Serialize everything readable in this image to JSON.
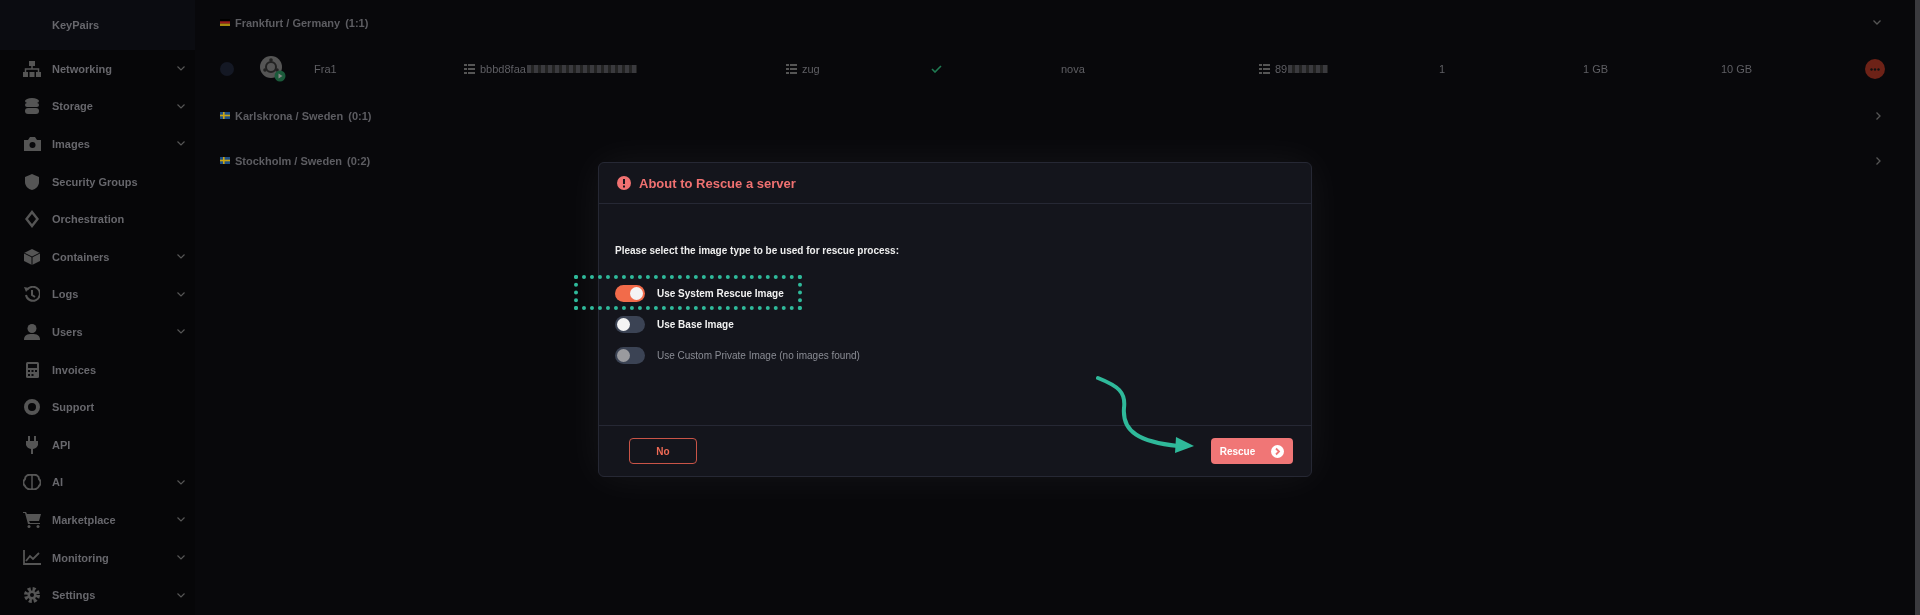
{
  "sidebar": {
    "items": [
      {
        "label": "KeyPairs",
        "expandable": false,
        "selected": true
      },
      {
        "label": "Networking",
        "expandable": true,
        "selected": false
      },
      {
        "label": "Storage",
        "expandable": true,
        "selected": false
      },
      {
        "label": "Images",
        "expandable": true,
        "selected": false
      },
      {
        "label": "Security Groups",
        "expandable": false,
        "selected": false
      },
      {
        "label": "Orchestration",
        "expandable": false,
        "selected": false
      },
      {
        "label": "Containers",
        "expandable": true,
        "selected": false
      },
      {
        "label": "Logs",
        "expandable": true,
        "selected": false
      },
      {
        "label": "Users",
        "expandable": true,
        "selected": false
      },
      {
        "label": "Invoices",
        "expandable": false,
        "selected": false
      },
      {
        "label": "Support",
        "expandable": false,
        "selected": false
      },
      {
        "label": "API",
        "expandable": false,
        "selected": false
      },
      {
        "label": "AI",
        "expandable": true,
        "selected": false
      },
      {
        "label": "Marketplace",
        "expandable": true,
        "selected": false
      },
      {
        "label": "Monitoring",
        "expandable": true,
        "selected": false
      },
      {
        "label": "Settings",
        "expandable": true,
        "selected": false
      }
    ]
  },
  "regions": [
    {
      "label": "Frankfurt / Germany",
      "count": "(1:1)",
      "expanded": true,
      "servers": [
        {
          "selected": false,
          "name": "Fra1",
          "id": "bbbd8faa",
          "flavor": "zug",
          "active": true,
          "zone": "nova",
          "ip": "89",
          "vcpus": "1",
          "ram": "1 GB",
          "disk": "10 GB"
        }
      ]
    },
    {
      "label": "Karlskrona / Sweden",
      "count": "(0:1)",
      "expanded": false
    },
    {
      "label": "Stockholm / Sweden",
      "count": "(0:2)",
      "expanded": false
    }
  ],
  "dialog": {
    "title": "About to Rescue a server",
    "prompt": "Please select the image type to be used for rescue process:",
    "options": [
      {
        "label": "Use System Rescue Image",
        "on": true,
        "disabled": false
      },
      {
        "label": "Use Base Image",
        "on": false,
        "disabled": false
      },
      {
        "label": "Use Custom Private Image (no images found)",
        "on": false,
        "disabled": true
      }
    ],
    "buttons": [
      {
        "label": "No",
        "kind": "outline"
      },
      {
        "label": "Rescue",
        "kind": "primary"
      }
    ]
  }
}
